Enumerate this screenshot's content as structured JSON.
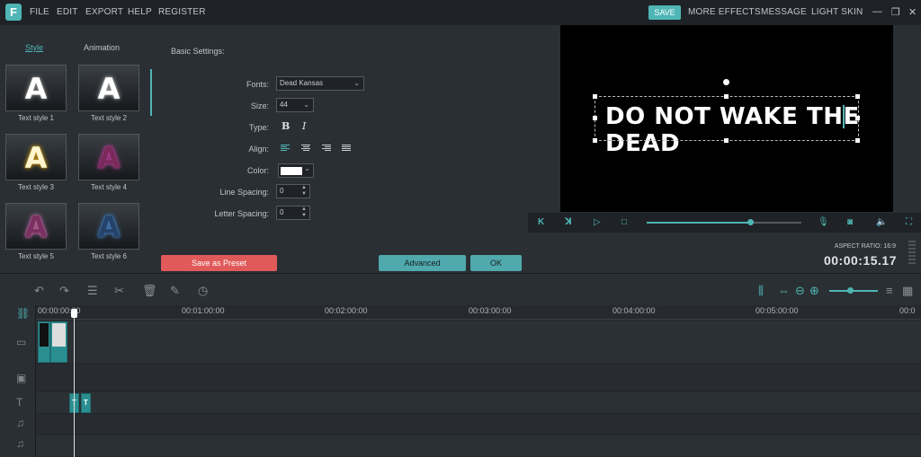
{
  "app": {
    "logo_letter": "F",
    "menu": [
      "FILE",
      "EDIT",
      "EXPORT",
      "HELP",
      "REGISTER"
    ],
    "right_menu": [
      "MORE EFFECTS",
      "MESSAGE",
      "LIGHT SKIN"
    ],
    "save_label": "SAVE",
    "window_controls": [
      "—",
      "❐",
      "✕"
    ],
    "accent": "#4fb5b5"
  },
  "style_panel": {
    "tabs": [
      "Style",
      "Animation"
    ],
    "active_tab": "Style",
    "styles": [
      {
        "label": "Text style 1",
        "glyph": "A",
        "color": "#ffffff",
        "glow": "#888888"
      },
      {
        "label": "Text style 2",
        "glyph": "A",
        "color": "#ffffff",
        "glow": "#aaaaaa"
      },
      {
        "label": "Text style 3",
        "glyph": "A",
        "color": "#fff6d0",
        "glow": "#d4a020"
      },
      {
        "label": "Text style 4",
        "glyph": "A",
        "color": "#7a2a5a",
        "glow": "#c040a0"
      },
      {
        "label": "Text style 5",
        "glyph": "A",
        "color": "#7a3060",
        "glow": "#d070b0"
      },
      {
        "label": "Text style 6",
        "glyph": "A",
        "color": "#24426a",
        "glow": "#4a8ad0"
      }
    ]
  },
  "settings": {
    "title": "Basic Settings:",
    "fonts_label": "Fonts:",
    "font_value": "Dead Kansas",
    "size_label": "Size:",
    "size_value": "44",
    "type_label": "Type:",
    "bold_label": "B",
    "italic_label": "I",
    "align_label": "Align:",
    "color_label": "Color:",
    "color_value": "#ffffff",
    "line_spacing_label": "Line Spacing:",
    "line_spacing_value": "0",
    "letter_spacing_label": "Letter Spacing:",
    "letter_spacing_value": "0"
  },
  "actions": {
    "save_preset": "Save as Preset",
    "advanced": "Advanced",
    "ok": "OK"
  },
  "preview": {
    "text": "DO NOT WAKE THE DEAD",
    "progress": 0.67,
    "aspect_ratio": "ASPECT RATIO: 16:9",
    "timecode": "00:00:15.17"
  },
  "timeline": {
    "ruler_labels": [
      "00:00:00:00",
      "00:01:00:00",
      "00:02:00:00",
      "00:03:00:00",
      "00:04:00:00",
      "00:05:00:00",
      "00:0"
    ],
    "text_clip_label": "T"
  }
}
